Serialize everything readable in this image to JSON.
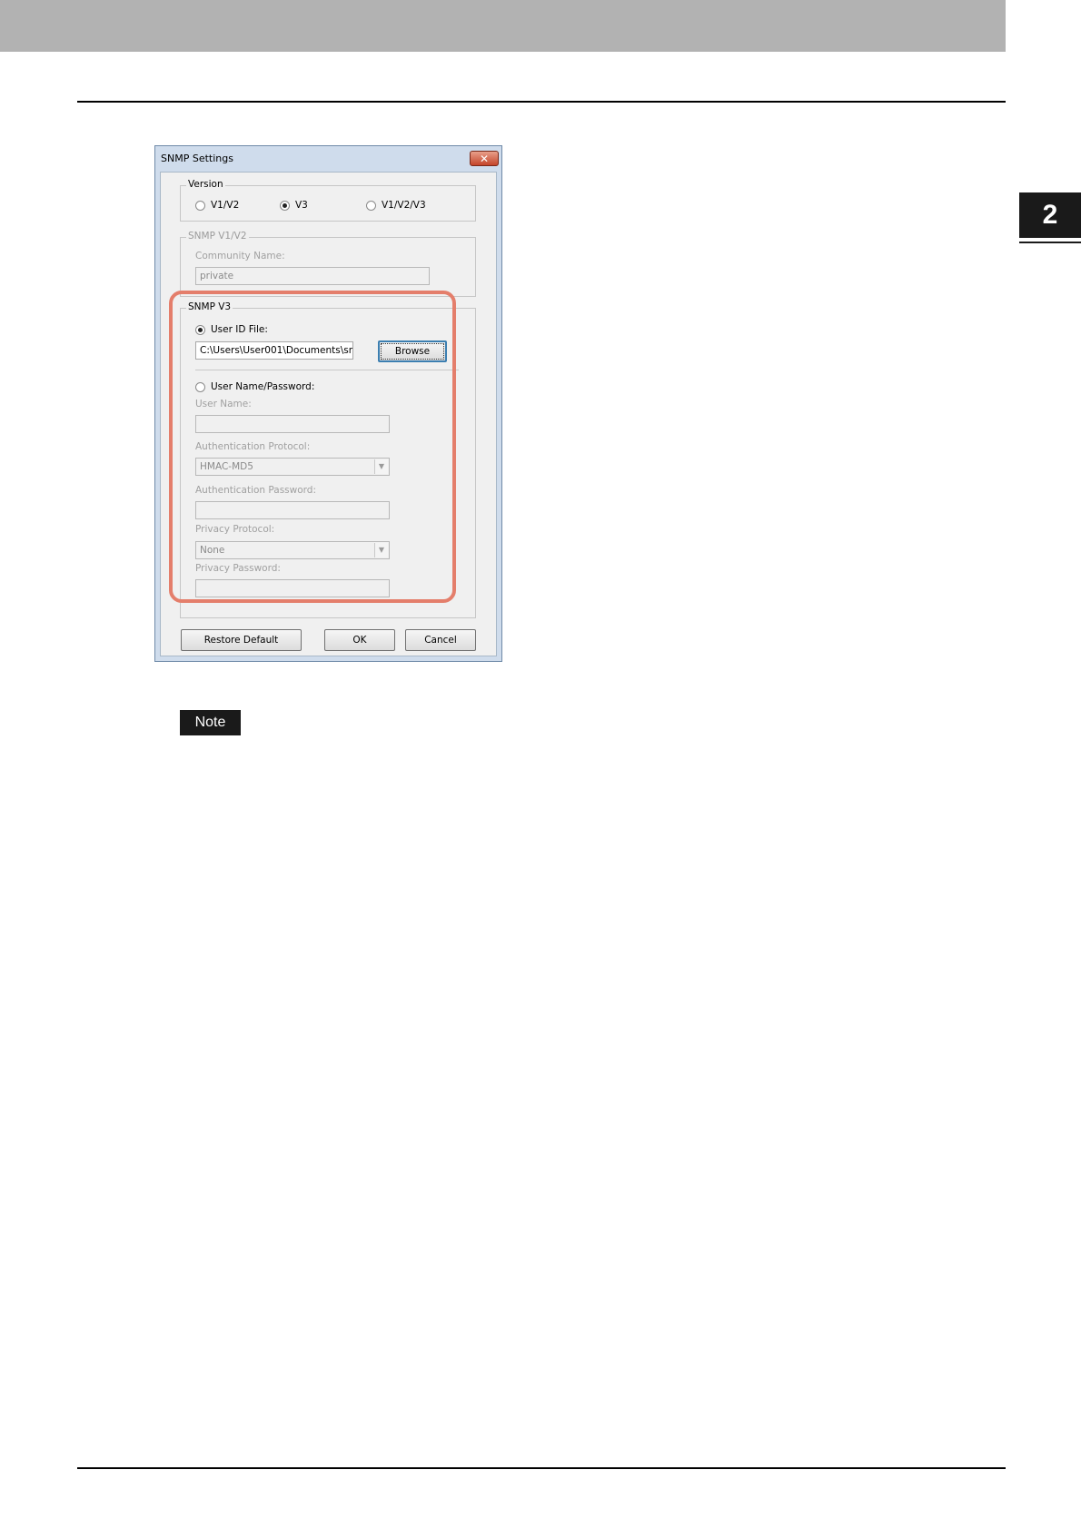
{
  "page": {
    "chapter_number": "2",
    "note_label": "Note",
    "accent_color": "#e47e6b"
  },
  "dialog": {
    "title": "SNMP Settings",
    "close_icon": "close-icon",
    "version_group": {
      "legend": "Version",
      "options": [
        {
          "label": "V1/V2",
          "checked": false
        },
        {
          "label": "V3",
          "checked": true
        },
        {
          "label": "V1/V2/V3",
          "checked": false
        }
      ]
    },
    "v1v2_group": {
      "legend": "SNMP V1/V2",
      "community_label": "Community Name:",
      "community_value": "private"
    },
    "v3_group": {
      "legend": "SNMP V3",
      "user_id_file_label": "User ID File:",
      "user_id_file_value": "C:\\Users\\User001\\Documents\\sn",
      "browse_label": "Browse",
      "user_name_password_label": "User Name/Password:",
      "user_name_label": "User Name:",
      "user_name_value": "",
      "auth_protocol_label": "Authentication Protocol:",
      "auth_protocol_value": "HMAC-MD5",
      "auth_password_label": "Authentication Password:",
      "auth_password_value": "",
      "privacy_protocol_label": "Privacy Protocol:",
      "privacy_protocol_value": "None",
      "privacy_password_label": "Privacy Password:",
      "privacy_password_value": ""
    },
    "buttons": {
      "restore_default": "Restore Default",
      "ok": "OK",
      "cancel": "Cancel"
    }
  }
}
